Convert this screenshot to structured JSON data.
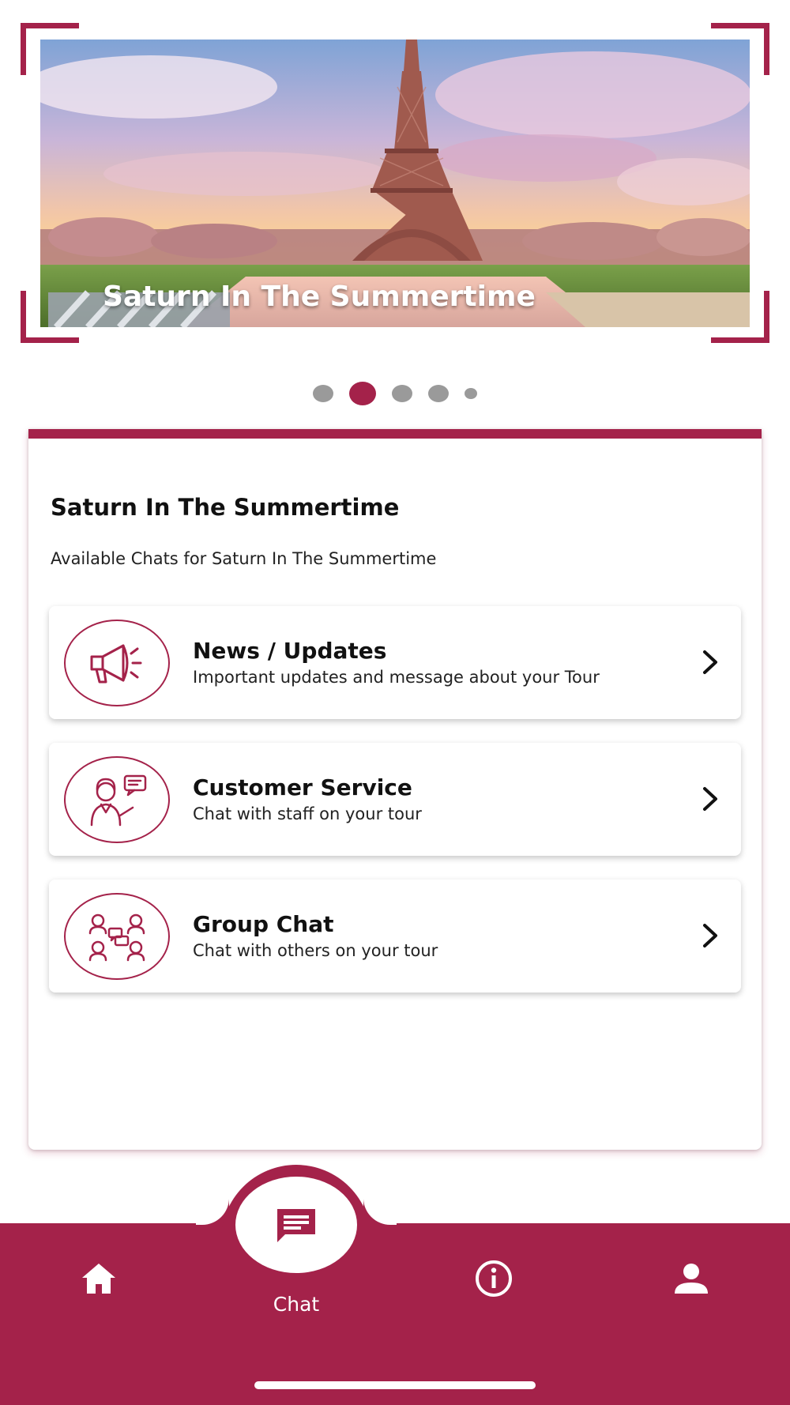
{
  "banner": {
    "caption": "Saturn In The Summertime",
    "image_subject": "Eiffel Tower at sunset"
  },
  "carousel": {
    "dot_count": 5,
    "active_index": 1
  },
  "card": {
    "title": "Saturn In The Summertime",
    "subtitle": "Available Chats for Saturn In The Summertime",
    "items": [
      {
        "title": "News / Updates",
        "description": "Important updates and message about your Tour",
        "icon": "megaphone-icon"
      },
      {
        "title": "Customer Service",
        "description": "Chat with staff on your tour",
        "icon": "customer-service-icon"
      },
      {
        "title": "Group Chat",
        "description": "Chat with others on your tour",
        "icon": "group-chat-icon"
      }
    ]
  },
  "nav": {
    "active": "chat",
    "chat_label": "Chat",
    "items": [
      "home-icon",
      "chat-icon",
      "info-icon",
      "profile-icon"
    ]
  },
  "colors": {
    "accent": "#a4224a",
    "inactive_dot": "#9a9a9a",
    "background": "#ffffff"
  }
}
